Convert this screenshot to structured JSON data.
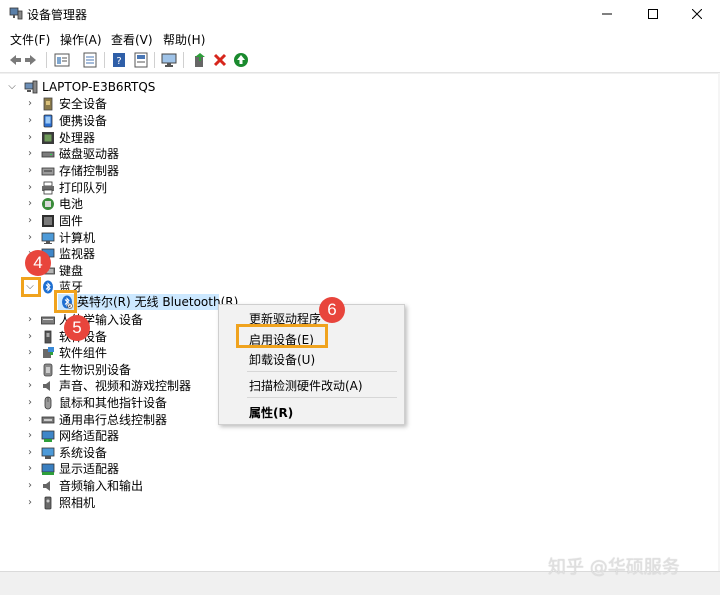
{
  "window": {
    "title": "设备管理器",
    "controls": [
      "minimize",
      "maximize",
      "close"
    ]
  },
  "menu": {
    "items": [
      "文件(F)",
      "操作(A)",
      "查看(V)",
      "帮助(H)"
    ]
  },
  "toolbar": {
    "icons": [
      "back-icon",
      "forward-icon",
      "properties-view-icon",
      "list-view-icon",
      "help-icon",
      "device-properties-icon",
      "monitor-scan-icon",
      "add-driver-icon",
      "uninstall-icon",
      "enable-icon"
    ]
  },
  "tree": {
    "root": "LAPTOP-E3B6RTQS",
    "categories": [
      {
        "label": "安全设备",
        "icon": "security-icon"
      },
      {
        "label": "便携设备",
        "icon": "portable-icon"
      },
      {
        "label": "处理器",
        "icon": "cpu-icon"
      },
      {
        "label": "磁盘驱动器",
        "icon": "disk-icon"
      },
      {
        "label": "存储控制器",
        "icon": "storage-icon"
      },
      {
        "label": "打印队列",
        "icon": "printer-icon"
      },
      {
        "label": "电池",
        "icon": "battery-icon"
      },
      {
        "label": "固件",
        "icon": "firmware-icon"
      },
      {
        "label": "计算机",
        "icon": "computer-icon"
      },
      {
        "label": "监视器",
        "icon": "monitor-icon"
      },
      {
        "label": "键盘",
        "icon": "keyboard-icon"
      },
      {
        "label": "蓝牙",
        "icon": "bluetooth-icon"
      },
      {
        "label": "英特尔(R) 无线 Bluetooth(R)",
        "icon": "bluetooth-device-icon"
      },
      {
        "label": "人体学输入设备",
        "icon": "hid-icon"
      },
      {
        "label": "软件设备",
        "icon": "software-device-icon"
      },
      {
        "label": "软件组件",
        "icon": "software-component-icon"
      },
      {
        "label": "生物识别设备",
        "icon": "biometric-icon"
      },
      {
        "label": "声音、视频和游戏控制器",
        "icon": "sound-icon"
      },
      {
        "label": "鼠标和其他指针设备",
        "icon": "mouse-icon"
      },
      {
        "label": "通用串行总线控制器",
        "icon": "usb-icon"
      },
      {
        "label": "网络适配器",
        "icon": "network-icon"
      },
      {
        "label": "系统设备",
        "icon": "system-icon"
      },
      {
        "label": "显示适配器",
        "icon": "display-adapter-icon"
      },
      {
        "label": "音频输入和输出",
        "icon": "audio-icon"
      },
      {
        "label": "照相机",
        "icon": "camera-icon"
      }
    ]
  },
  "context_menu": {
    "items": [
      "更新驱动程序",
      "启用设备(E)",
      "卸载设备(U)",
      "扫描检测硬件改动(A)",
      "属性(R)"
    ]
  },
  "annotations": {
    "badges": [
      "4",
      "5",
      "6"
    ]
  },
  "watermark": "知乎 @华硕服务",
  "colors": {
    "highlight": "#f0a31e",
    "badge": "#e8453c",
    "selection": "#cce8ff"
  }
}
